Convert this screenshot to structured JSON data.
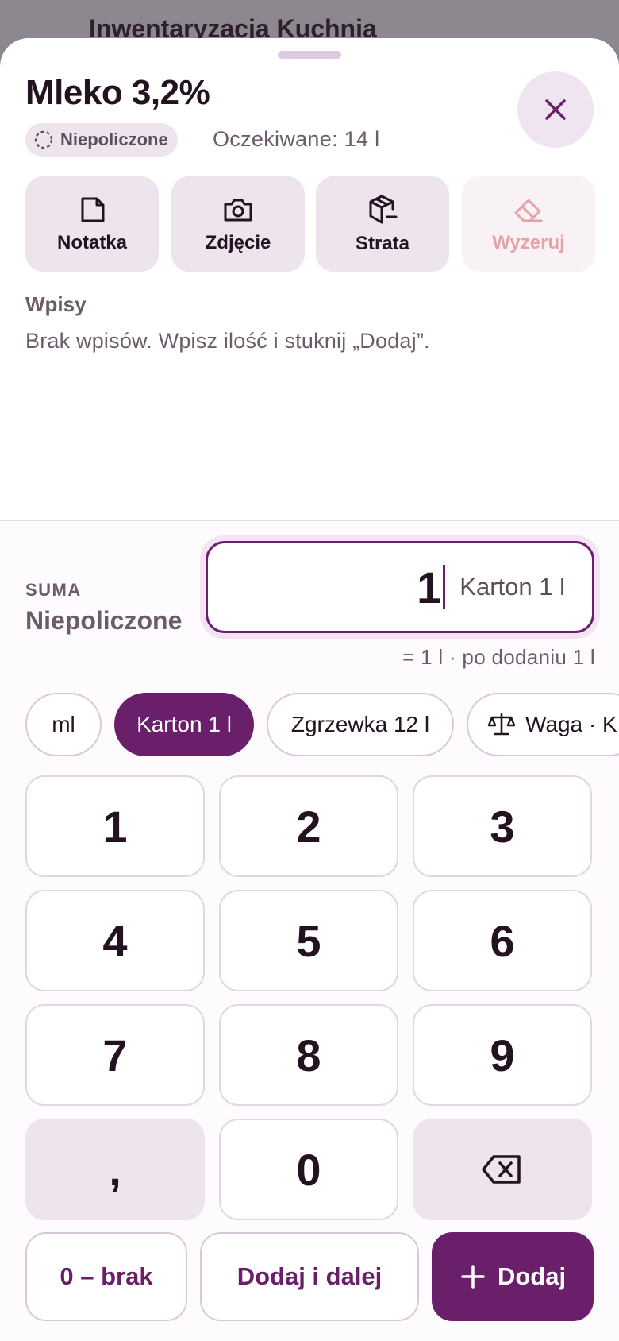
{
  "background": {
    "title": "Inwentaryzacja Kuchnia"
  },
  "item": {
    "title": "Mleko 3,2%",
    "status": "Niepoliczone",
    "expected": "Oczekiwane: 14 l"
  },
  "actions": [
    {
      "label": "Notatka",
      "icon": "note-icon",
      "disabled": false
    },
    {
      "label": "Zdjęcie",
      "icon": "camera-icon",
      "disabled": false
    },
    {
      "label": "Strata",
      "icon": "package-minus-icon",
      "disabled": false
    },
    {
      "label": "Wyzeruj",
      "icon": "eraser-icon",
      "disabled": true
    }
  ],
  "entries": {
    "heading": "Wpisy",
    "empty": "Brak wpisów. Wpisz ilość i stuknij „Dodaj”."
  },
  "sum": {
    "label": "SUMA",
    "value": "Niepoliczone"
  },
  "quantity": {
    "value": "1",
    "unit": "Karton 1 l",
    "conversion": "= 1 l · po dodaniu 1 l"
  },
  "units": [
    {
      "label": "ml",
      "selected": false
    },
    {
      "label": "Karton 1 l",
      "selected": true
    },
    {
      "label": "Zgrzewka 12 l",
      "selected": false
    },
    {
      "label": "Waga · K",
      "selected": false,
      "icon": "scale-icon"
    }
  ],
  "keypad": {
    "keys": [
      "1",
      "2",
      "3",
      "4",
      "5",
      "6",
      "7",
      "8",
      "9",
      ",",
      "0"
    ],
    "backspace_icon": "backspace-icon"
  },
  "buttons": {
    "zero_missing": "0 – brak",
    "add_next": "Dodaj i dalej",
    "add": "Dodaj"
  },
  "colors": {
    "accent": "#6a1f6b",
    "accent_light": "#f3e4f3",
    "muted_text": "#6a5c69",
    "danger_disabled": "#e5a3a6"
  }
}
